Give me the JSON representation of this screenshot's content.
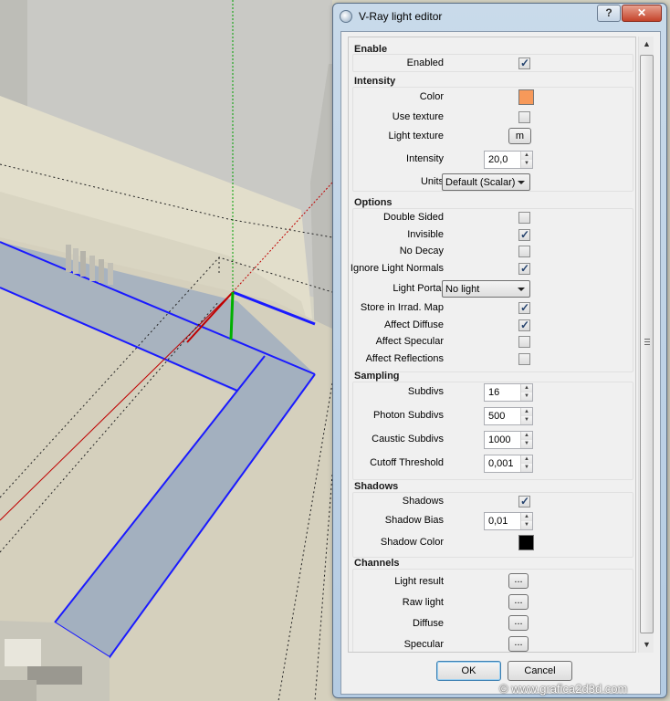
{
  "window": {
    "title": "V-Ray light editor",
    "help_glyph": "?",
    "close_glyph": "✕"
  },
  "groups": {
    "enable": {
      "title": "Enable",
      "enabled_label": "Enabled",
      "enabled": true
    },
    "intensity": {
      "title": "Intensity",
      "color_label": "Color",
      "color_value": "#f7995a",
      "use_texture_label": "Use texture",
      "use_texture": false,
      "light_texture_label": "Light texture",
      "light_texture_button": "m",
      "intensity_label": "Intensity",
      "intensity_value": "20,0",
      "units_label": "Units",
      "units_value": "Default (Scalar)"
    },
    "options": {
      "title": "Options",
      "double_sided_label": "Double Sided",
      "double_sided": false,
      "invisible_label": "Invisible",
      "invisible": true,
      "no_decay_label": "No Decay",
      "no_decay": false,
      "ignore_light_normals_label": "Ignore Light Normals",
      "ignore_light_normals": true,
      "light_portal_label": "Light Portal",
      "light_portal_value": "No light",
      "store_irrad_label": "Store in Irrad. Map",
      "store_irrad": true,
      "affect_diffuse_label": "Affect Diffuse",
      "affect_diffuse": true,
      "affect_specular_label": "Affect Specular",
      "affect_specular": false,
      "affect_reflections_label": "Affect Reflections",
      "affect_reflections": false
    },
    "sampling": {
      "title": "Sampling",
      "subdivs_label": "Subdivs",
      "subdivs_value": "16",
      "photon_subdivs_label": "Photon Subdivs",
      "photon_subdivs_value": "500",
      "caustic_subdivs_label": "Caustic Subdivs",
      "caustic_subdivs_value": "1000",
      "cutoff_label": "Cutoff Threshold",
      "cutoff_value": "0,001"
    },
    "shadows": {
      "title": "Shadows",
      "shadows_label": "Shadows",
      "shadows": true,
      "shadow_bias_label": "Shadow Bias",
      "shadow_bias_value": "0,01",
      "shadow_color_label": "Shadow Color",
      "shadow_color_value": "#000000"
    },
    "channels": {
      "title": "Channels",
      "ellipsis": "...",
      "items": [
        "Light result",
        "Raw light",
        "Diffuse",
        "Specular"
      ]
    }
  },
  "footer": {
    "ok_label": "OK",
    "cancel_label": "Cancel"
  },
  "watermark": "© www.grafica2d3d.com",
  "colors": {
    "selection_blue": "#1a1aff",
    "axis_red": "#c00000",
    "axis_green": "#00b000",
    "blue_floor": "#a3b0bf"
  }
}
